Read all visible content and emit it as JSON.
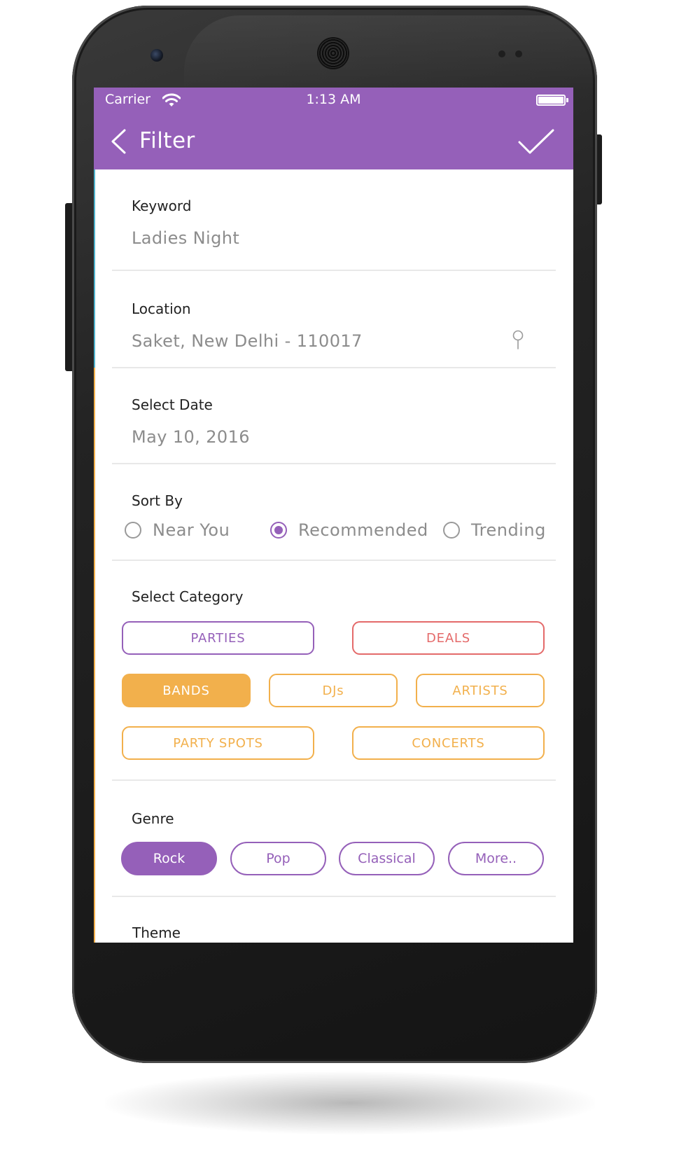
{
  "status_bar": {
    "carrier": "Carrier",
    "time": "1:13 AM"
  },
  "header": {
    "title": "Filter"
  },
  "keyword": {
    "label": "Keyword",
    "value": "Ladies Night"
  },
  "location": {
    "label": "Location",
    "value": "Saket, New Delhi - 110017"
  },
  "date": {
    "label": "Select Date",
    "value": "May 10, 2016"
  },
  "sort": {
    "label": "Sort By",
    "options": [
      "Near You",
      "Recommended",
      "Trending"
    ],
    "selected": "Recommended"
  },
  "category": {
    "label": "Select Category",
    "items": [
      "PARTIES",
      "DEALS",
      "BANDS",
      "DJs",
      "ARTISTS",
      "PARTY SPOTS",
      "CONCERTS"
    ],
    "selected": "BANDS"
  },
  "genre": {
    "label": "Genre",
    "items": [
      "Rock",
      "Pop",
      "Classical",
      "More.."
    ],
    "selected": "Rock"
  },
  "theme": {
    "label": "Theme"
  },
  "colors": {
    "primary": "#9560b9",
    "deals": "#e46a6a",
    "category_accent": "#f2b04c",
    "text_muted": "#8c8c8c"
  }
}
